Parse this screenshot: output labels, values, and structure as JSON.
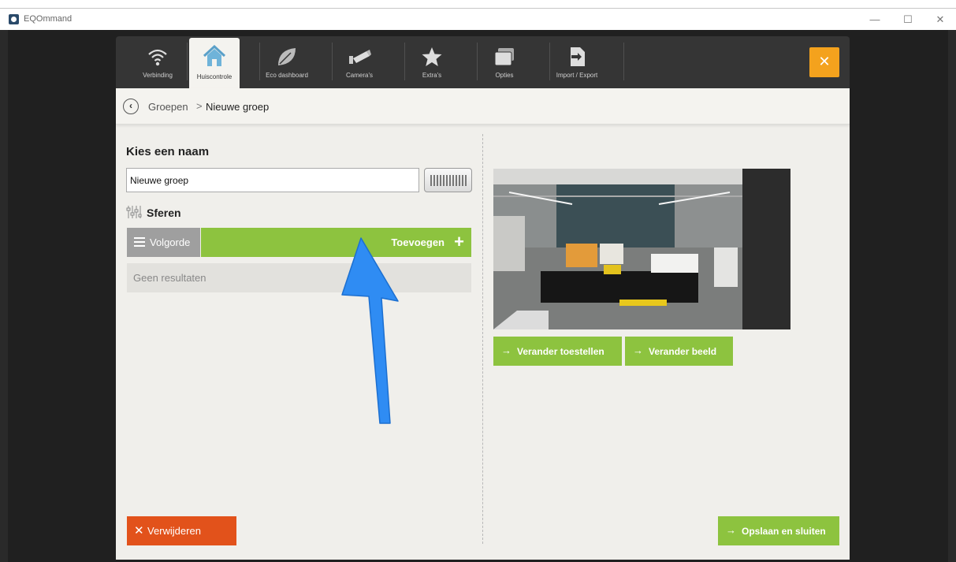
{
  "window": {
    "title": "EQOmmand",
    "minimize": "—",
    "maximize": "☐",
    "close": "✕"
  },
  "tabs": [
    {
      "label": "Verbinding",
      "icon": "wifi-icon",
      "active": false
    },
    {
      "label": "Huiscontrole",
      "icon": "home-icon",
      "active": true
    },
    {
      "label": "Eco dashboard",
      "icon": "leaf-icon",
      "active": false
    },
    {
      "label": "Camera's",
      "icon": "camera-icon",
      "active": false
    },
    {
      "label": "Extra's",
      "icon": "star-icon",
      "active": false
    },
    {
      "label": "Opties",
      "icon": "windows-icon",
      "active": false
    },
    {
      "label": "Import / Export",
      "icon": "import-export-icon",
      "active": false
    }
  ],
  "close_panel_label": "✕",
  "breadcrumb": {
    "back": "‹",
    "parent": "Groepen",
    "separator": ">",
    "current": "Nieuwe groep"
  },
  "form": {
    "name_heading": "Kies een naam",
    "name_value": "Nieuwe groep",
    "sferen_heading": "Sferen",
    "order_label": "Volgorde",
    "add_label": "Toevoegen",
    "add_symbol": "+",
    "empty_text": "Geen resultaten",
    "delete_symbol": "✕",
    "delete_label": "Verwijderen"
  },
  "right": {
    "change_devices": "Verander toestellen",
    "change_image": "Verander beeld",
    "save_close": "Opslaan en sluiten",
    "arrow": "→"
  },
  "colors": {
    "green": "#8dc33f",
    "orange": "#f4a21d",
    "red": "#e2521b",
    "annotation_blue": "#2f8cf3"
  }
}
